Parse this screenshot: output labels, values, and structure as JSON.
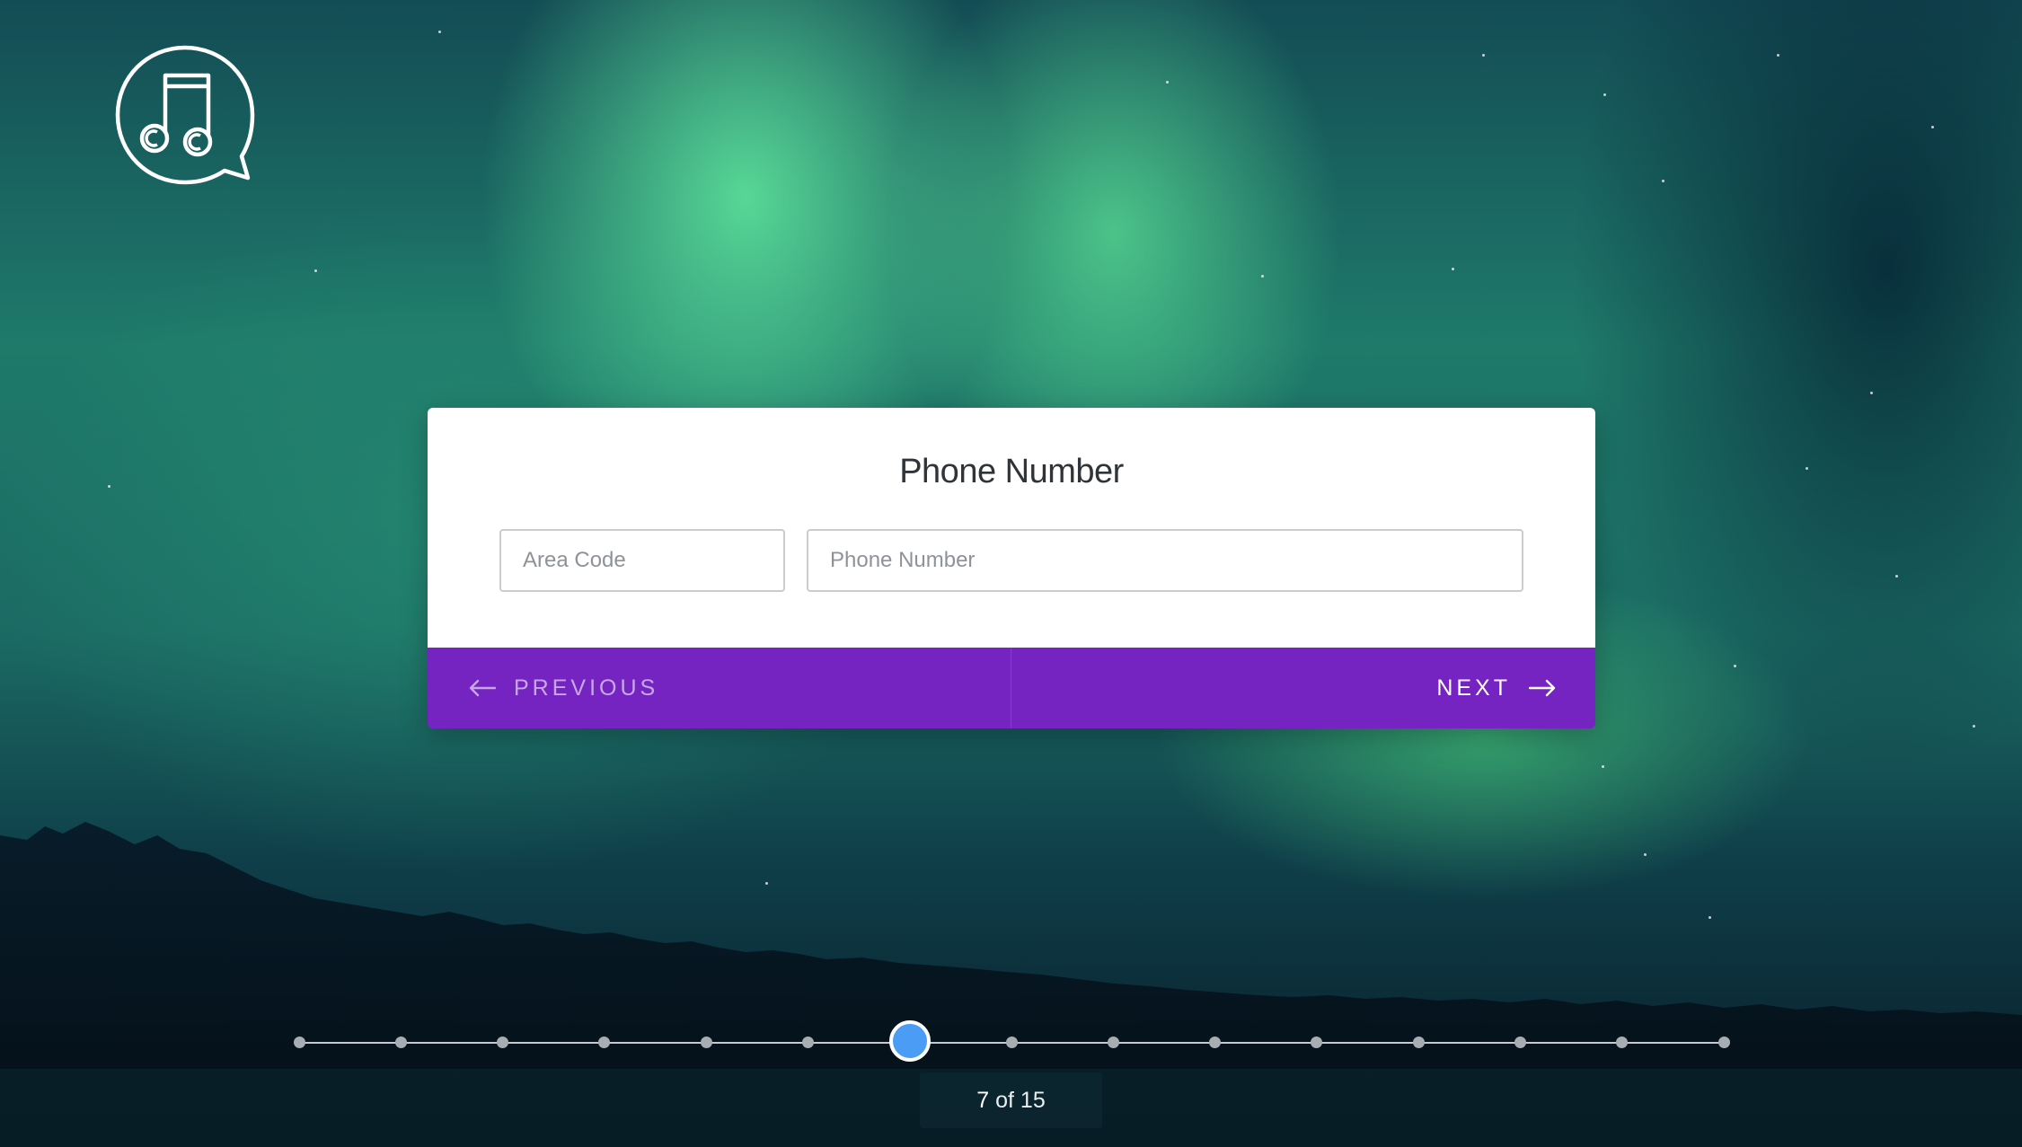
{
  "logo": {
    "icon": "music-notes-chat-bubble"
  },
  "card": {
    "title": "Phone Number",
    "area_code": {
      "placeholder": "Area Code",
      "value": ""
    },
    "phone_number": {
      "placeholder": "Phone Number",
      "value": ""
    },
    "previous_label": "PREVIOUS",
    "next_label": "NEXT"
  },
  "progress": {
    "current": "7",
    "of_word": "of",
    "total": "15",
    "current_index": 7,
    "total_steps": 15
  },
  "colors": {
    "accent": "#7523c1",
    "handle": "#4a9cf5",
    "card_background": "#ffffff",
    "title_text": "#2f3438"
  },
  "icons": {
    "previous": "arrow-left-icon",
    "next": "arrow-right-icon"
  }
}
